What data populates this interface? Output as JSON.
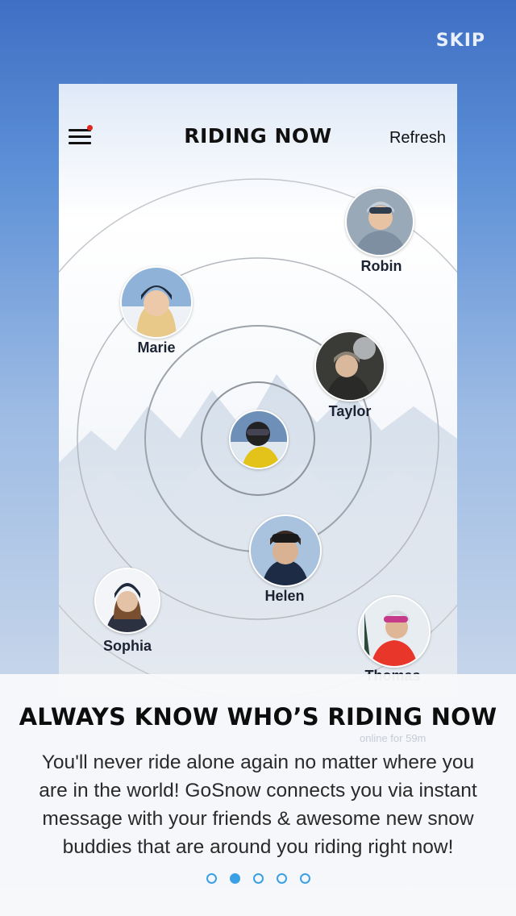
{
  "skip_label": "SKIP",
  "app": {
    "title": "RIDING NOW",
    "refresh_label": "Refresh",
    "menu_icon": "hamburger-menu-icon",
    "notification_color": "#e1261c"
  },
  "users": [
    {
      "name": "Robin"
    },
    {
      "name": "Marie"
    },
    {
      "name": "Taylor"
    },
    {
      "name": "Helen"
    },
    {
      "name": "Sophia"
    },
    {
      "name": "Thomas"
    }
  ],
  "ghost_text": "online for 59m",
  "panel": {
    "title": "ALWAYS KNOW WHO’S RIDING NOW",
    "body": "You'll never ride alone again no matter where you are in the world! GoSnow connects you via instant message with your friends & awesome new snow buddies that are around you riding right now!"
  },
  "pager": {
    "count": 5,
    "active_index": 1,
    "color": "#3aa0e6"
  }
}
